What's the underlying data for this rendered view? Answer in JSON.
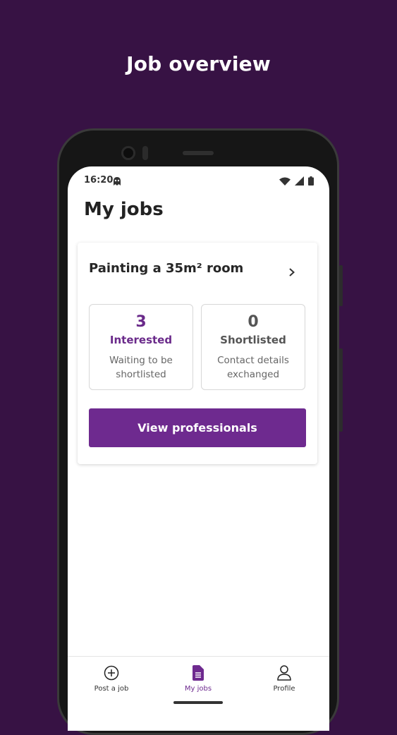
{
  "banner": {
    "headline": "Job overview"
  },
  "status_bar": {
    "time": "16:20",
    "icons": [
      "app-notification-icon",
      "wifi-icon",
      "cellular-signal-icon",
      "battery-icon"
    ]
  },
  "page": {
    "title": "My jobs"
  },
  "job": {
    "title": "Painting a 35m² room",
    "stats": [
      {
        "count": "3",
        "name": "Interested",
        "desc": "Waiting to be shortlisted"
      },
      {
        "count": "0",
        "name": "Shortlisted",
        "desc": "Contact details exchanged"
      }
    ],
    "cta_label": "View professionals"
  },
  "nav": {
    "items": [
      {
        "label": "Post a job",
        "icon": "plus-circle-icon"
      },
      {
        "label": "My jobs",
        "icon": "document-icon",
        "active": true
      },
      {
        "label": "Profile",
        "icon": "person-icon"
      }
    ]
  },
  "colors": {
    "background": "#371244",
    "accent": "#6e2a8f",
    "interested": "#6a2a8a"
  }
}
